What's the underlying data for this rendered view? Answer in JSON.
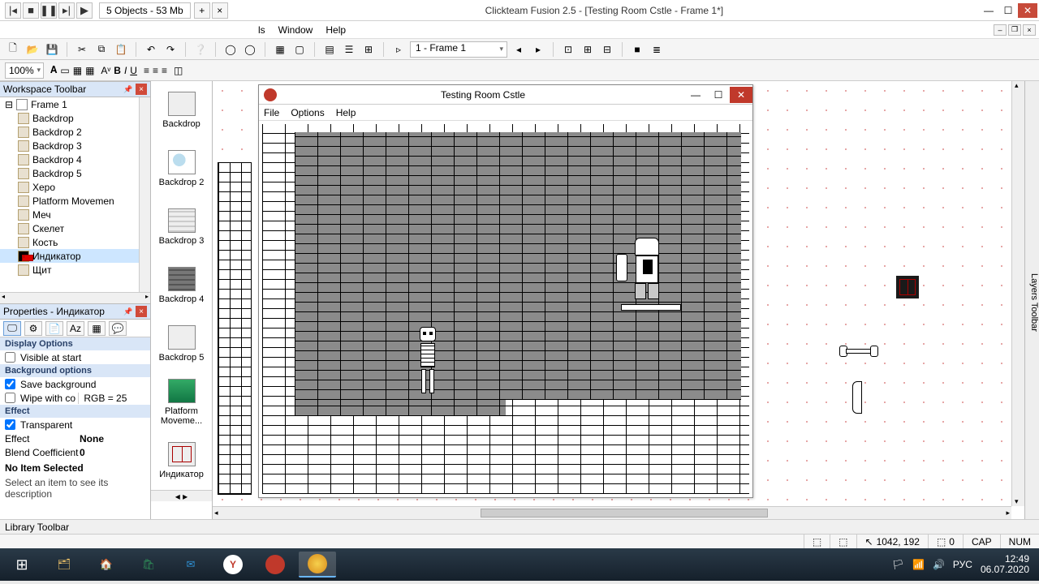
{
  "app": {
    "title": "Clickteam Fusion 2.5 - [Testing Room Cstle - Frame 1*]",
    "tab": "5 Objects - 53 Mb"
  },
  "menubar": {
    "items": [
      "ls",
      "Window",
      "Help"
    ]
  },
  "toolbar": {
    "frame_selector": "1 - Frame 1",
    "zoom": "100%"
  },
  "workspace": {
    "title": "Workspace Toolbar",
    "root": "Frame 1",
    "items": [
      "Backdrop",
      "Backdrop 2",
      "Backdrop 3",
      "Backdrop 4",
      "Backdrop 5",
      "Xepo",
      "Platform Movemen",
      "Меч",
      "Скелет",
      "Кость",
      "Индикатор",
      "Щит"
    ],
    "selected_index": 10
  },
  "properties": {
    "title": "Properties - Индикатор",
    "sections": {
      "display": "Display Options",
      "background": "Background options",
      "effect": "Effect"
    },
    "rows": {
      "visible": {
        "label": "Visible at start",
        "checked": false
      },
      "savebg": {
        "label": "Save background",
        "checked": true
      },
      "wipe": {
        "label": "Wipe with co",
        "value": "RGB = 25",
        "checked": false
      },
      "transparent": {
        "label": "Transparent",
        "checked": true
      },
      "effect": {
        "k": "Effect",
        "v": "None"
      },
      "blend": {
        "k": "Blend Coefficient",
        "v": "0"
      }
    },
    "noitem": "No Item Selected",
    "desc": "Select an item to see its description"
  },
  "objects": [
    {
      "label": "Backdrop",
      "icon": "brick"
    },
    {
      "label": "Backdrop 2",
      "icon": "splash"
    },
    {
      "label": "Backdrop 3",
      "icon": "brick-lt"
    },
    {
      "label": "Backdrop 4",
      "icon": "brick-dk"
    },
    {
      "label": "Backdrop 5",
      "icon": "blank"
    },
    {
      "label": "Platform Moveme...",
      "icon": "active"
    },
    {
      "label": "Индикатор",
      "icon": "indic"
    }
  ],
  "inner_window": {
    "title": "Testing Room Cstle",
    "menu": [
      "File",
      "Options",
      "Help"
    ]
  },
  "layers_strip": "Layers Toolbar",
  "library": "Library Toolbar",
  "status": {
    "coords": "1042, 192",
    "sel": "0",
    "caps": "CAP",
    "num": "NUM"
  },
  "taskbar": {
    "lang": "РУС",
    "time": "12:49",
    "date": "06.07.2020"
  }
}
